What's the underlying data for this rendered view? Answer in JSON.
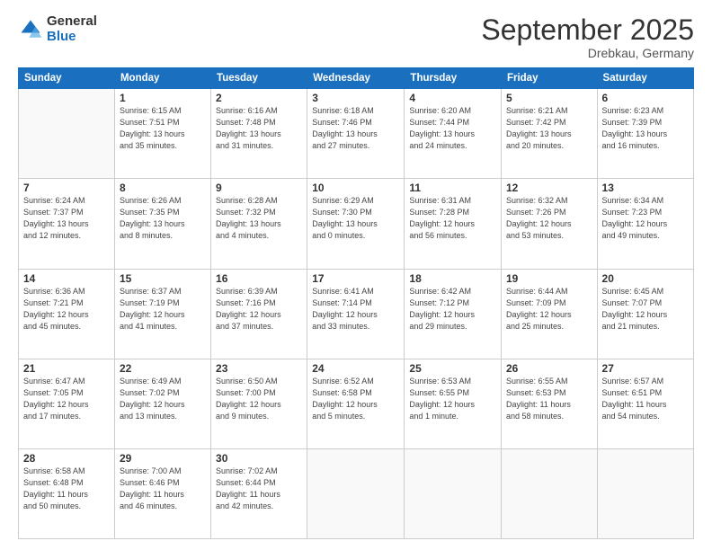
{
  "logo": {
    "general": "General",
    "blue": "Blue"
  },
  "header": {
    "month": "September 2025",
    "location": "Drebkau, Germany"
  },
  "weekdays": [
    "Sunday",
    "Monday",
    "Tuesday",
    "Wednesday",
    "Thursday",
    "Friday",
    "Saturday"
  ],
  "weeks": [
    [
      {
        "day": "",
        "info": ""
      },
      {
        "day": "1",
        "info": "Sunrise: 6:15 AM\nSunset: 7:51 PM\nDaylight: 13 hours\nand 35 minutes."
      },
      {
        "day": "2",
        "info": "Sunrise: 6:16 AM\nSunset: 7:48 PM\nDaylight: 13 hours\nand 31 minutes."
      },
      {
        "day": "3",
        "info": "Sunrise: 6:18 AM\nSunset: 7:46 PM\nDaylight: 13 hours\nand 27 minutes."
      },
      {
        "day": "4",
        "info": "Sunrise: 6:20 AM\nSunset: 7:44 PM\nDaylight: 13 hours\nand 24 minutes."
      },
      {
        "day": "5",
        "info": "Sunrise: 6:21 AM\nSunset: 7:42 PM\nDaylight: 13 hours\nand 20 minutes."
      },
      {
        "day": "6",
        "info": "Sunrise: 6:23 AM\nSunset: 7:39 PM\nDaylight: 13 hours\nand 16 minutes."
      }
    ],
    [
      {
        "day": "7",
        "info": "Sunrise: 6:24 AM\nSunset: 7:37 PM\nDaylight: 13 hours\nand 12 minutes."
      },
      {
        "day": "8",
        "info": "Sunrise: 6:26 AM\nSunset: 7:35 PM\nDaylight: 13 hours\nand 8 minutes."
      },
      {
        "day": "9",
        "info": "Sunrise: 6:28 AM\nSunset: 7:32 PM\nDaylight: 13 hours\nand 4 minutes."
      },
      {
        "day": "10",
        "info": "Sunrise: 6:29 AM\nSunset: 7:30 PM\nDaylight: 13 hours\nand 0 minutes."
      },
      {
        "day": "11",
        "info": "Sunrise: 6:31 AM\nSunset: 7:28 PM\nDaylight: 12 hours\nand 56 minutes."
      },
      {
        "day": "12",
        "info": "Sunrise: 6:32 AM\nSunset: 7:26 PM\nDaylight: 12 hours\nand 53 minutes."
      },
      {
        "day": "13",
        "info": "Sunrise: 6:34 AM\nSunset: 7:23 PM\nDaylight: 12 hours\nand 49 minutes."
      }
    ],
    [
      {
        "day": "14",
        "info": "Sunrise: 6:36 AM\nSunset: 7:21 PM\nDaylight: 12 hours\nand 45 minutes."
      },
      {
        "day": "15",
        "info": "Sunrise: 6:37 AM\nSunset: 7:19 PM\nDaylight: 12 hours\nand 41 minutes."
      },
      {
        "day": "16",
        "info": "Sunrise: 6:39 AM\nSunset: 7:16 PM\nDaylight: 12 hours\nand 37 minutes."
      },
      {
        "day": "17",
        "info": "Sunrise: 6:41 AM\nSunset: 7:14 PM\nDaylight: 12 hours\nand 33 minutes."
      },
      {
        "day": "18",
        "info": "Sunrise: 6:42 AM\nSunset: 7:12 PM\nDaylight: 12 hours\nand 29 minutes."
      },
      {
        "day": "19",
        "info": "Sunrise: 6:44 AM\nSunset: 7:09 PM\nDaylight: 12 hours\nand 25 minutes."
      },
      {
        "day": "20",
        "info": "Sunrise: 6:45 AM\nSunset: 7:07 PM\nDaylight: 12 hours\nand 21 minutes."
      }
    ],
    [
      {
        "day": "21",
        "info": "Sunrise: 6:47 AM\nSunset: 7:05 PM\nDaylight: 12 hours\nand 17 minutes."
      },
      {
        "day": "22",
        "info": "Sunrise: 6:49 AM\nSunset: 7:02 PM\nDaylight: 12 hours\nand 13 minutes."
      },
      {
        "day": "23",
        "info": "Sunrise: 6:50 AM\nSunset: 7:00 PM\nDaylight: 12 hours\nand 9 minutes."
      },
      {
        "day": "24",
        "info": "Sunrise: 6:52 AM\nSunset: 6:58 PM\nDaylight: 12 hours\nand 5 minutes."
      },
      {
        "day": "25",
        "info": "Sunrise: 6:53 AM\nSunset: 6:55 PM\nDaylight: 12 hours\nand 1 minute."
      },
      {
        "day": "26",
        "info": "Sunrise: 6:55 AM\nSunset: 6:53 PM\nDaylight: 11 hours\nand 58 minutes."
      },
      {
        "day": "27",
        "info": "Sunrise: 6:57 AM\nSunset: 6:51 PM\nDaylight: 11 hours\nand 54 minutes."
      }
    ],
    [
      {
        "day": "28",
        "info": "Sunrise: 6:58 AM\nSunset: 6:48 PM\nDaylight: 11 hours\nand 50 minutes."
      },
      {
        "day": "29",
        "info": "Sunrise: 7:00 AM\nSunset: 6:46 PM\nDaylight: 11 hours\nand 46 minutes."
      },
      {
        "day": "30",
        "info": "Sunrise: 7:02 AM\nSunset: 6:44 PM\nDaylight: 11 hours\nand 42 minutes."
      },
      {
        "day": "",
        "info": ""
      },
      {
        "day": "",
        "info": ""
      },
      {
        "day": "",
        "info": ""
      },
      {
        "day": "",
        "info": ""
      }
    ]
  ]
}
